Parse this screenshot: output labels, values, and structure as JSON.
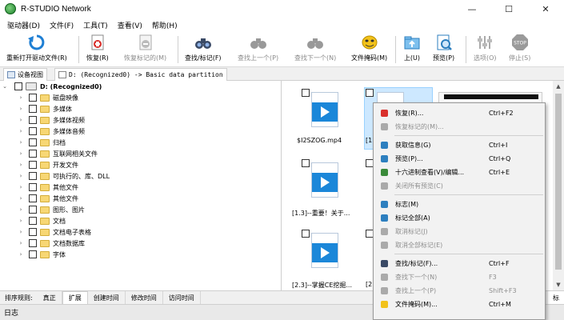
{
  "window": {
    "title": "R-STUDIO Network",
    "controls": [
      "—",
      "☐",
      "✕"
    ]
  },
  "menu": [
    "驱动器(D)",
    "文件(F)",
    "工具(T)",
    "查看(V)",
    "帮助(H)"
  ],
  "toolbar": {
    "reopen": "重新打开驱动文件(R)",
    "recover": "恢复(R)",
    "recover_marked": "恢复标记的(M)",
    "find_mark": "查找/标记(F)",
    "find_prev": "查找上一个(P)",
    "find_next": "查找下一个(N)",
    "file_mask": "文件掩码(M)",
    "up": "上(U)",
    "preview": "预览(P)",
    "options": "选项(O)",
    "stop": "停止(S)"
  },
  "tabs": {
    "device_view": "设备视图",
    "path": "D: (Recognized0) -> Basic data partition"
  },
  "tree": {
    "root": "D: (Recognized0)",
    "items": [
      "磁盘映像",
      "多媒体",
      "多媒体视频",
      "多媒体音频",
      "归档",
      "互联网相关文件",
      "开发文件",
      "可执行的、库、DLL",
      "其他文件",
      "其他文件",
      "图形、图片",
      "文档",
      "文档电子表格",
      "文档数据库",
      "字体"
    ]
  },
  "files": [
    {
      "name": "$I2SZOG.mp4"
    },
    {
      "name": "[1.3]--重要！关于..."
    },
    {
      "name": "[2.3]--掌握CE挖掘..."
    },
    {
      "name": "[1."
    },
    {
      "name": "[2."
    }
  ],
  "context_menu": {
    "items": [
      {
        "label": "恢复(R)...",
        "shortcut": "Ctrl+F2",
        "icon": "recover-icon",
        "disabled": false
      },
      {
        "label": "恢复标记的(M)...",
        "shortcut": "",
        "icon": "recover-marked-icon",
        "disabled": true
      },
      {
        "label": "获取信息(G)",
        "shortcut": "Ctrl+I",
        "icon": "info-icon",
        "disabled": false
      },
      {
        "label": "预览(P)...",
        "shortcut": "Ctrl+Q",
        "icon": "preview-icon",
        "disabled": false
      },
      {
        "label": "十六进制查看(V)/编辑...",
        "shortcut": "Ctrl+E",
        "icon": "hex-icon",
        "disabled": false
      },
      {
        "label": "关闭所有预览(C)",
        "shortcut": "",
        "icon": "close-preview-icon",
        "disabled": true
      },
      {
        "label": "标志(M)",
        "shortcut": "",
        "icon": "mark-icon",
        "disabled": false
      },
      {
        "label": "标记全部(A)",
        "shortcut": "",
        "icon": "mark-all-icon",
        "disabled": false
      },
      {
        "label": "取消标记(J)",
        "shortcut": "",
        "icon": "unmark-icon",
        "disabled": true
      },
      {
        "label": "取消全部标记(E)",
        "shortcut": "",
        "icon": "unmark-all-icon",
        "disabled": true
      },
      {
        "label": "查找/标记(F)...",
        "shortcut": "Ctrl+F",
        "icon": "find-icon",
        "disabled": false
      },
      {
        "label": "查找下一个(N)",
        "shortcut": "F3",
        "icon": "find-next-icon",
        "disabled": true
      },
      {
        "label": "查找上一个(P)",
        "shortcut": "Shift+F3",
        "icon": "find-prev-icon",
        "disabled": true
      },
      {
        "label": "文件掩码(M)...",
        "shortcut": "Ctrl+M",
        "icon": "mask-icon",
        "disabled": false
      }
    ]
  },
  "sortbar": {
    "label": "排序规则:",
    "tabs": [
      "真正",
      "扩展",
      "创建时间",
      "修改时间",
      "访问时间"
    ],
    "right": "标"
  },
  "log": "日志",
  "colors": {
    "accent": "#1b87d9",
    "selection": "#cde8ff"
  }
}
